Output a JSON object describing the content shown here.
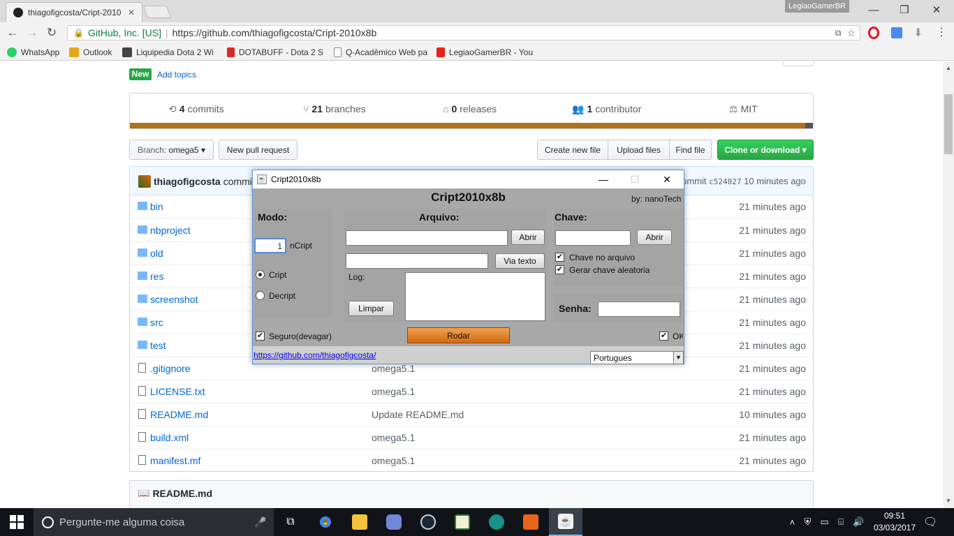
{
  "browser": {
    "tab_title": "thiagofigcosta/Cript-2010",
    "profile": "LegiaoGamerBR",
    "secure_label": "GitHub, Inc. [US]",
    "url": "https://github.com/thiagofigcosta/Cript-2010x8b",
    "bookmarks": [
      {
        "label": "WhatsApp",
        "color": "#25d366"
      },
      {
        "label": "Outlook",
        "color": "#e6a817"
      },
      {
        "label": "Liquipedia Dota 2 Wi",
        "color": "#444444"
      },
      {
        "label": "DOTABUFF - Dota 2 S",
        "color": "#d92a2a"
      },
      {
        "label": "Q-Acadêmico Web pa",
        "color": "#dddddd"
      },
      {
        "label": "LegiaoGamerBR - You",
        "color": "#e62117"
      }
    ]
  },
  "repo": {
    "new_badge": "New",
    "add_topics": "Add topics",
    "commits_count": "4",
    "commits_label": "commits",
    "branches_count": "21",
    "branches_label": "branches",
    "releases_count": "0",
    "releases_label": "releases",
    "contributors_count": "1",
    "contributors_label": "contributor",
    "license": "MIT",
    "branch_prefix": "Branch:",
    "branch_name": "omega5 ▾",
    "new_pull_request": "New pull request",
    "create_new_file": "Create new file",
    "upload_files": "Upload files",
    "find_file": "Find file",
    "clone_download": "Clone or download ▾",
    "committer": "thiagofigcosta",
    "committed_text": "committe",
    "commit_prefix": "ommit",
    "commit_sha": "c524027",
    "commit_age": "10 minutes ago",
    "readme_title": "README.md",
    "files": [
      {
        "name": "bin",
        "type": "folder",
        "message": "",
        "age": "21 minutes ago"
      },
      {
        "name": "nbproject",
        "type": "folder",
        "message": "",
        "age": "21 minutes ago"
      },
      {
        "name": "old",
        "type": "folder",
        "message": "",
        "age": "21 minutes ago"
      },
      {
        "name": "res",
        "type": "folder",
        "message": "",
        "age": "21 minutes ago"
      },
      {
        "name": "screenshot",
        "type": "folder",
        "message": "",
        "age": "21 minutes ago"
      },
      {
        "name": "src",
        "type": "folder",
        "message": "",
        "age": "21 minutes ago"
      },
      {
        "name": "test",
        "type": "folder",
        "message": "",
        "age": "21 minutes ago"
      },
      {
        "name": ".gitignore",
        "type": "file",
        "message": "omega5.1",
        "age": "21 minutes ago"
      },
      {
        "name": "LICENSE.txt",
        "type": "file",
        "message": "omega5.1",
        "age": "21 minutes ago"
      },
      {
        "name": "README.md",
        "type": "file",
        "message": "Update README.md",
        "age": "10 minutes ago"
      },
      {
        "name": "build.xml",
        "type": "file",
        "message": "omega5.1",
        "age": "21 minutes ago"
      },
      {
        "name": "manifest.mf",
        "type": "file",
        "message": "omega5.1",
        "age": "21 minutes ago"
      }
    ]
  },
  "app": {
    "window_title": "Cript2010x8b",
    "heading": "Cript2010x8b",
    "by": "by: nanoTech",
    "modo_label": "Modo:",
    "ncript_value": "1",
    "ncript_label": "nCript",
    "cript_label": "Cript",
    "decript_label": "Decript",
    "arquivo_label": "Arquivo:",
    "abrir_label": "Abrir",
    "via_texto_label": "Via  texto",
    "log_label": "Log:",
    "limpar_label": "Limpar",
    "chave_label": "Chave:",
    "chave_abrir_label": "Abrir",
    "chave_no_arquivo": "Chave no arquivo",
    "gerar_chave": "Gerar chave aleatoria",
    "senha_label": "Senha:",
    "seguro_label": "Seguro(devagar)",
    "rodar_label": "Rodar",
    "ok_label": "OK",
    "link": "https://github.com/thiagofigcosta/",
    "language": "Portugues"
  },
  "taskbar": {
    "search_placeholder": "Pergunte-me alguma coisa",
    "time": "09:51",
    "date": "03/03/2017"
  }
}
